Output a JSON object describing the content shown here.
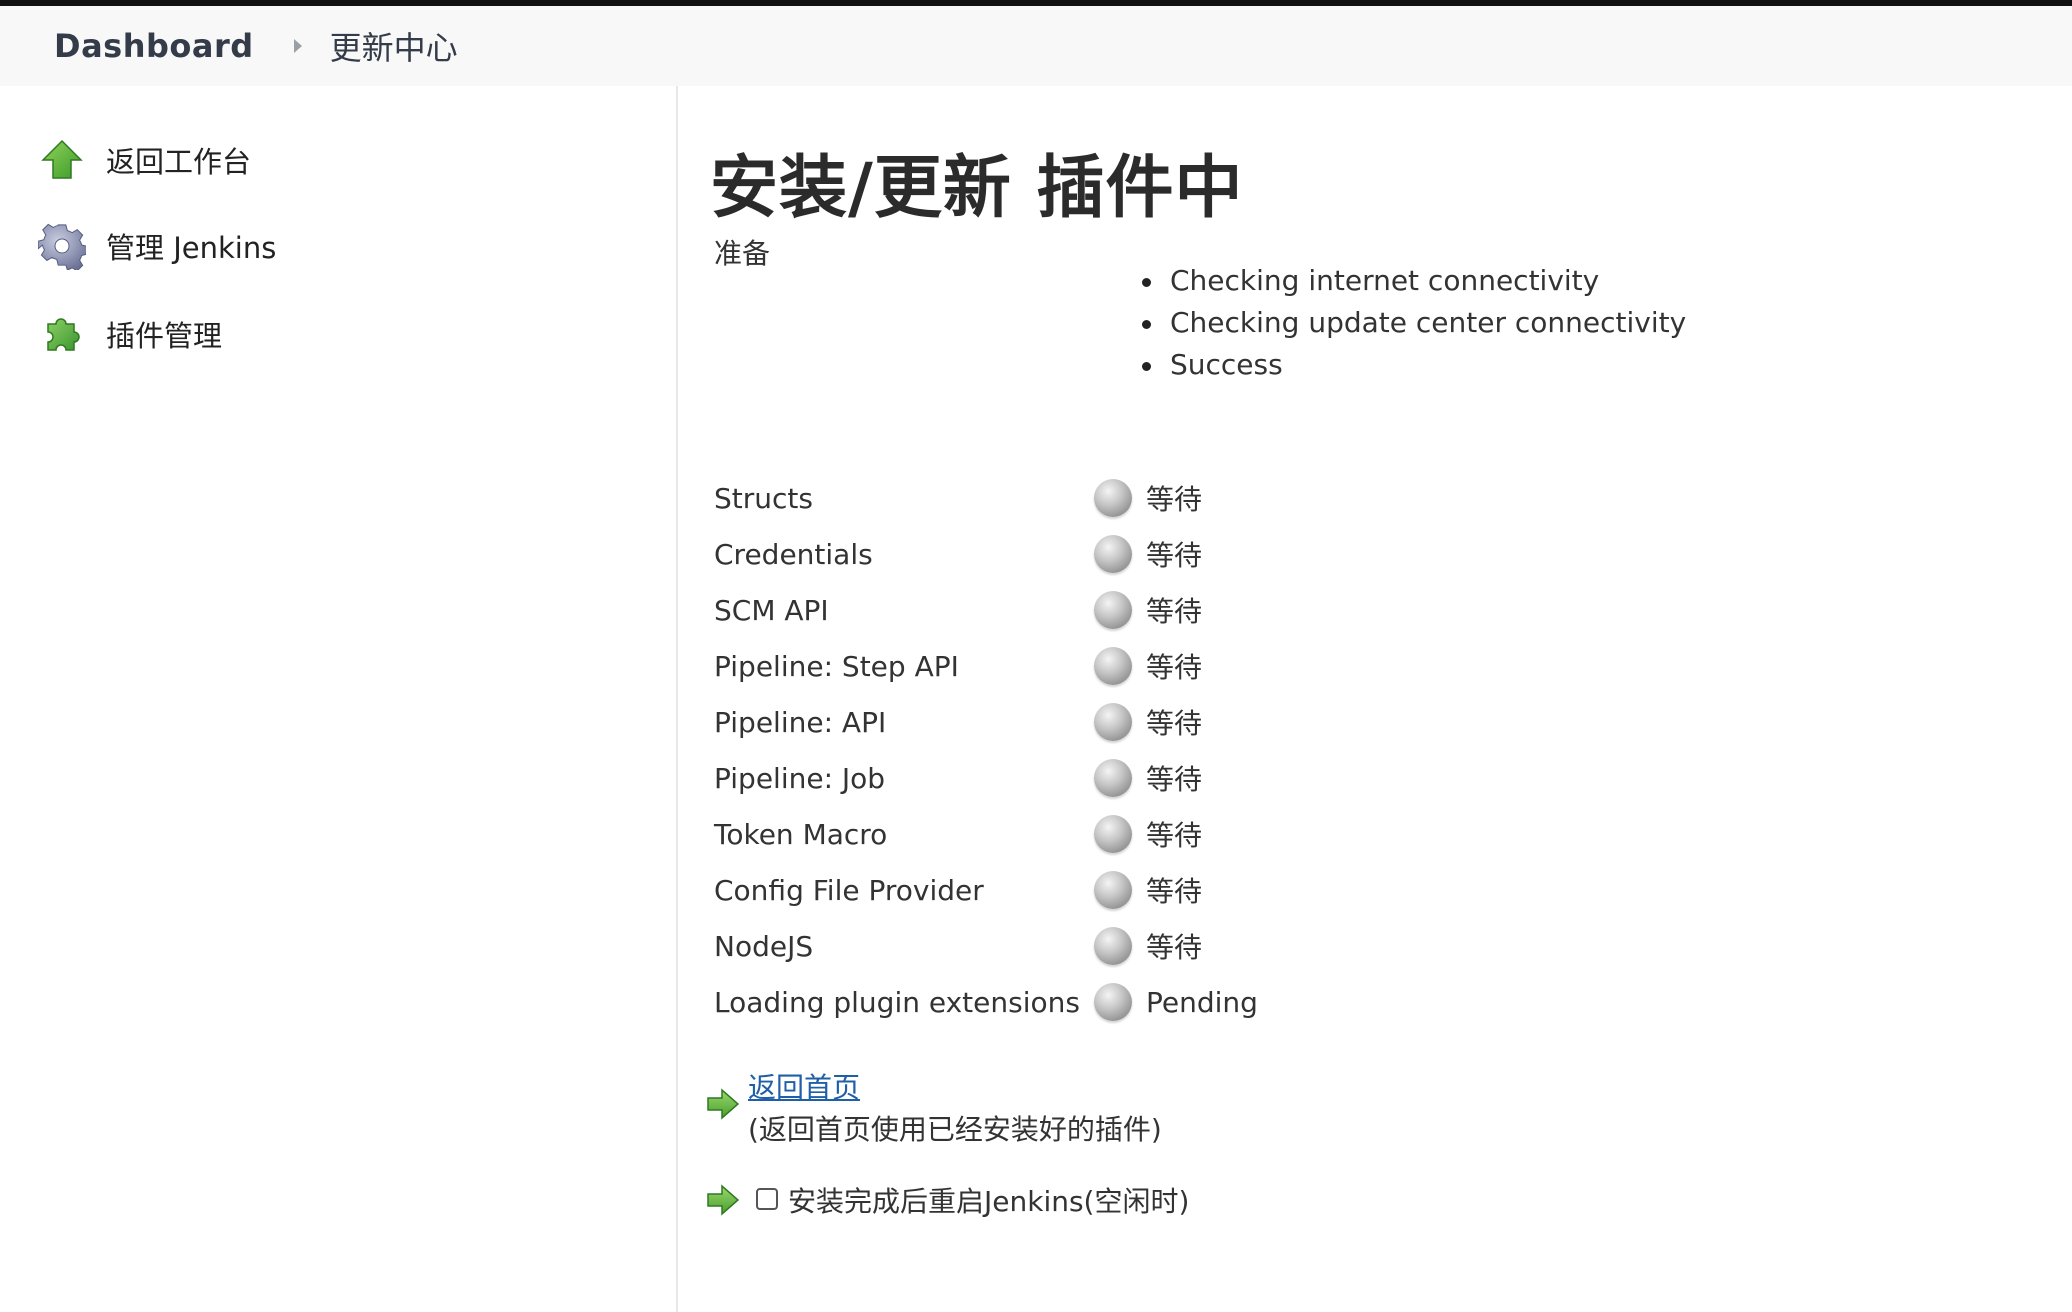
{
  "breadcrumb": {
    "home": "Dashboard",
    "current": "更新中心"
  },
  "sidebar": {
    "items": [
      {
        "label": "返回工作台",
        "icon": "up-arrow-icon"
      },
      {
        "label": "管理 Jenkins",
        "icon": "gear-icon"
      },
      {
        "label": "插件管理",
        "icon": "puzzle-icon"
      }
    ]
  },
  "main": {
    "title": "安装/更新 插件中",
    "prep_label": "准备",
    "checks": [
      "Checking internet connectivity",
      "Checking update center connectivity",
      "Success"
    ],
    "plugins": [
      {
        "name": "Structs",
        "status": "等待"
      },
      {
        "name": "Credentials",
        "status": "等待"
      },
      {
        "name": "SCM API",
        "status": "等待"
      },
      {
        "name": "Pipeline: Step API",
        "status": "等待"
      },
      {
        "name": "Pipeline: API",
        "status": "等待"
      },
      {
        "name": "Pipeline: Job",
        "status": "等待"
      },
      {
        "name": "Token Macro",
        "status": "等待"
      },
      {
        "name": "Config File Provider",
        "status": "等待"
      },
      {
        "name": "NodeJS",
        "status": "等待"
      },
      {
        "name": "Loading plugin extensions",
        "status": "Pending"
      }
    ],
    "back_link": "返回首页",
    "back_desc": "(返回首页使用已经安装好的插件)",
    "restart_label": "安装完成后重启Jenkins(空闲时)",
    "restart_checked": false
  },
  "colors": {
    "link": "#1f5fa8",
    "status_pending": "#9e9e9e",
    "arrow_green": "#5fae3a"
  }
}
